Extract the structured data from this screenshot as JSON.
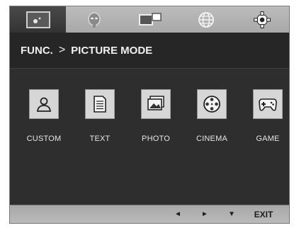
{
  "tabs": [
    {
      "name": "picture-tab",
      "icon": "picture-adjust-icon",
      "active": true
    },
    {
      "name": "face-tab",
      "icon": "face-icon",
      "active": false
    },
    {
      "name": "screens-tab",
      "icon": "screens-icon",
      "active": false
    },
    {
      "name": "globe-tab",
      "icon": "globe-icon",
      "active": false
    },
    {
      "name": "settings-tab",
      "icon": "gear-icon",
      "active": false
    }
  ],
  "breadcrumb": {
    "parent": "FUNC.",
    "separator": ">",
    "current": "PICTURE MODE"
  },
  "modes": [
    {
      "label": "CUSTOM",
      "icon": "person-icon"
    },
    {
      "label": "TEXT",
      "icon": "document-icon"
    },
    {
      "label": "PHOTO",
      "icon": "photo-icon"
    },
    {
      "label": "CINEMA",
      "icon": "film-reel-icon"
    },
    {
      "label": "GAME",
      "icon": "gamepad-icon"
    }
  ],
  "bottom": {
    "left_arrow": "◄",
    "right_arrow": "►",
    "down_arrow": "▼",
    "exit_label": "EXIT"
  },
  "colors": {
    "panel_bg": "#2e2e2e",
    "tabbar_bg": "#b0b0b0",
    "active_tab_bg": "#3a3a3a",
    "icon_box_bg": "#d6d6d6"
  }
}
